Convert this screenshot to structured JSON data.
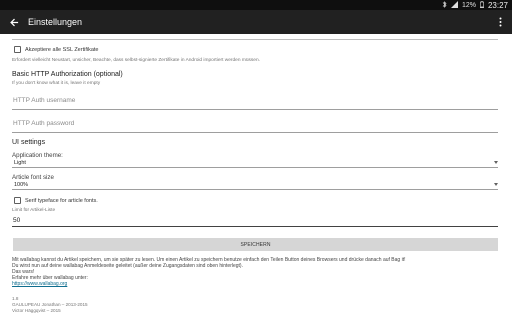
{
  "status_bar": {
    "battery": "12%",
    "time": "23:27"
  },
  "app_bar": {
    "title": "Einstellungen"
  },
  "settings": {
    "ssl_checkbox_label": "Akzeptiere alle SSL Zertifikate",
    "ssl_hint": "Erfordert vielleicht Neustart, unsicher, Beachte, dass selbst-signierte Zertifikate in Android importiert werden müssen.",
    "http_auth_heading": "Basic HTTP Authorization (optional)",
    "http_auth_hint": "If you don't know what it is, leave it empty",
    "http_user_placeholder": "HTTP Auth username",
    "http_pass_placeholder": "HTTP Auth password",
    "ui_heading": "UI settings",
    "theme_label": "Application theme:",
    "theme_value": "Light",
    "font_size_label": "Article font size",
    "font_size_value": "100%",
    "serif_checkbox_label": "Serif typeface for article fonts.",
    "limit_label": "Limit für Artikel-Liste",
    "limit_value": "50",
    "save_button": "SPEICHERN"
  },
  "info": {
    "line1": "Mit wallabag kannst du Artikel speichern, um sie später zu lesen. Um einen Artikel zu speichern benutze einfach den Teilen Button deines Browsers und drücke danach auf Bag it!",
    "line2": "Du wirst nun auf deine wallabag Anmeldeseite geleitet (außer deine Zugangsdaten sind oben hinterlegt).",
    "line3": "Das wars!",
    "line4": "Erfahre mehr über wallabag unter:",
    "link": "https://www.wallabag.org"
  },
  "footer": {
    "version": "1.8",
    "credit1": "GAULUPEAU Jonathan – 2013-2015",
    "credit2": "Victor Häggqvist – 2015"
  },
  "icons": {
    "back": "arrow-left-icon",
    "menu": "overflow-menu-icon",
    "bluetooth": "bluetooth-icon",
    "signal": "signal-icon",
    "battery": "battery-icon",
    "dropdown": "dropdown-arrow-icon"
  }
}
